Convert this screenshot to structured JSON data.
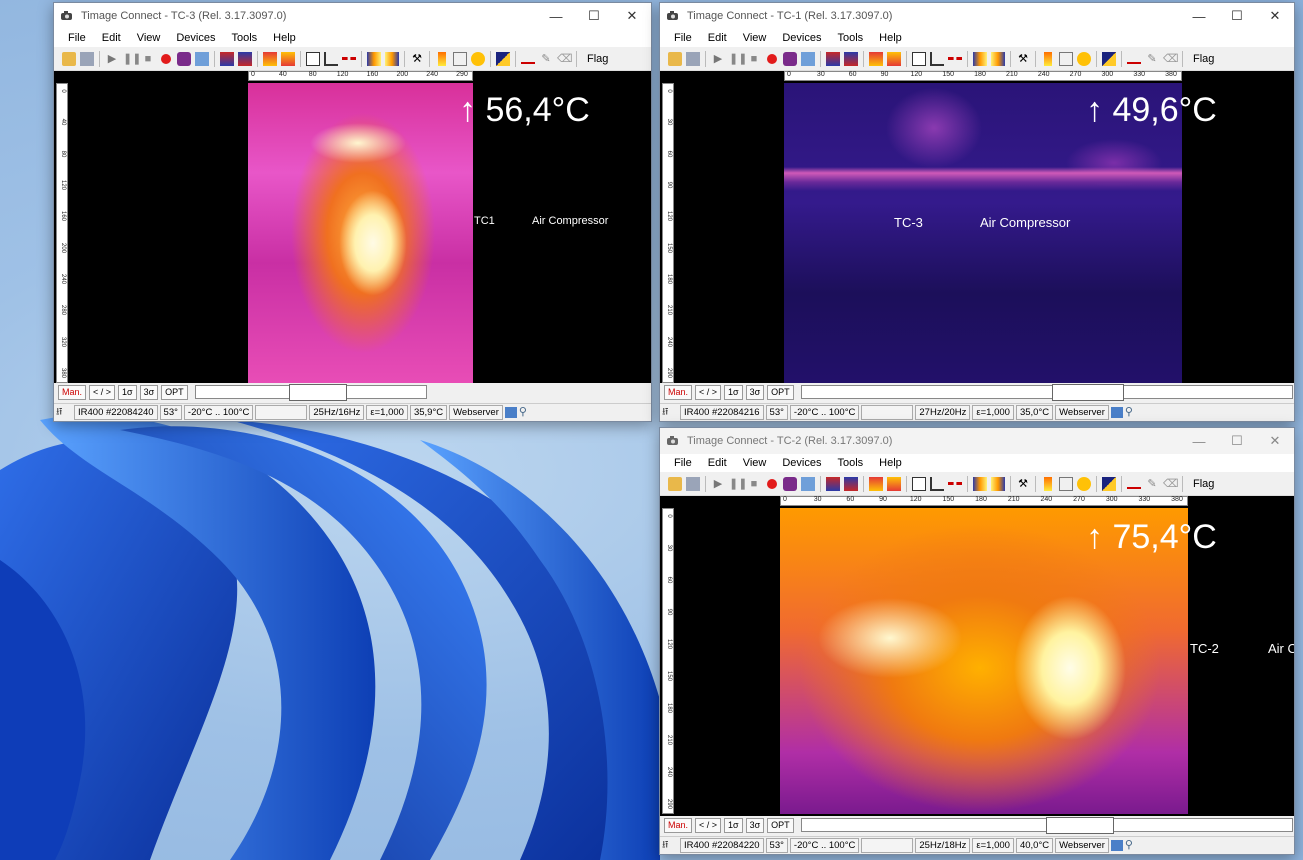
{
  "menu": [
    "File",
    "Edit",
    "View",
    "Devices",
    "Tools",
    "Help"
  ],
  "toolbar": {
    "flag_label": "Flag"
  },
  "controls": {
    "man": "Man.",
    "range": "< / >",
    "sigma1": "1σ",
    "sigma3": "3σ",
    "opt": "OPT"
  },
  "status_common": {
    "fov": "53°",
    "range": "-20°C .. 100°C",
    "emissivity": "ε=1,000",
    "webserver": "Webserver"
  },
  "windows": [
    {
      "title": "Timage Connect - TC-3 (Rel. 3.17.3097.0)",
      "temp": "↑ 56,4°C",
      "label_cam": "TC1",
      "label_name": "Air Compressor",
      "device": "IR400 #22084240",
      "fps": "25Hz/16Hz",
      "ambient": "35,9°C",
      "hticks": [
        "0",
        "40",
        "80",
        "120",
        "160",
        "200",
        "240",
        "290"
      ],
      "vticks": [
        "0",
        "40",
        "80",
        "120",
        "160",
        "200",
        "240",
        "280",
        "320",
        "380"
      ],
      "slider_level": 0.54
    },
    {
      "title": "Timage Connect - TC-1 (Rel. 3.17.3097.0)",
      "temp": "↑ 49,6°C",
      "label_cam": "TC-3",
      "label_name": "Air Compressor",
      "device": "IR400 #22084216",
      "fps": "27Hz/20Hz",
      "ambient": "35,0°C",
      "hticks": [
        "0",
        "30",
        "60",
        "90",
        "120",
        "150",
        "180",
        "210",
        "240",
        "270",
        "300",
        "330",
        "380"
      ],
      "vticks": [
        "0",
        "30",
        "60",
        "90",
        "120",
        "150",
        "180",
        "210",
        "240",
        "290"
      ],
      "slider_level": 0.6
    },
    {
      "title": "Timage Connect - TC-2 (Rel. 3.17.3097.0)",
      "temp": "↑ 75,4°C",
      "label_cam": "TC-2",
      "label_name": "Air C",
      "device": "IR400 #22084220",
      "fps": "25Hz/18Hz",
      "ambient": "40,0°C",
      "hticks": [
        "0",
        "30",
        "60",
        "90",
        "120",
        "150",
        "180",
        "210",
        "240",
        "270",
        "300",
        "330",
        "380"
      ],
      "vticks": [
        "0",
        "30",
        "60",
        "90",
        "120",
        "150",
        "180",
        "210",
        "240",
        "290"
      ],
      "slider_level": 0.58
    }
  ]
}
